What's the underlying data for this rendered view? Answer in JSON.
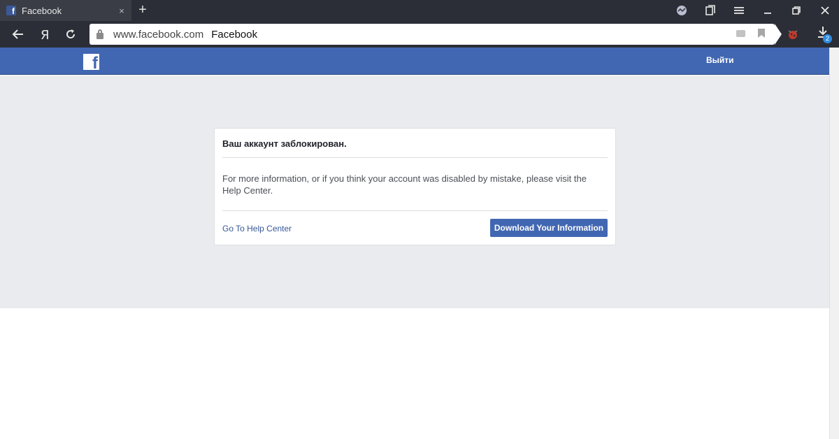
{
  "browser": {
    "tab": {
      "title": "Facebook",
      "favicon": "f",
      "close": "×"
    },
    "new_tab": "+",
    "address": {
      "url": "www.facebook.com",
      "page_title": "Facebook"
    },
    "downloads_count": "2",
    "icons": [
      "back-arrow-icon",
      "yandex-icon",
      "reload-icon",
      "lock-icon",
      "chat-icon",
      "bookmark-icon",
      "extension-icon",
      "download-icon",
      "protect-icon",
      "bookmarks-panel-icon",
      "menu-icon",
      "minimize-icon",
      "restore-icon",
      "close-icon"
    ]
  },
  "fb_header": {
    "logo": "f",
    "logout_label": "Выйти",
    "color": "#4267b2"
  },
  "dialog": {
    "title": "Ваш аккаунт заблокирован.",
    "body": "For more information, or if you think your account was disabled by mistake, please visit the Help Center.",
    "help_link": "Go To Help Center",
    "download_button": "Download Your Information"
  }
}
